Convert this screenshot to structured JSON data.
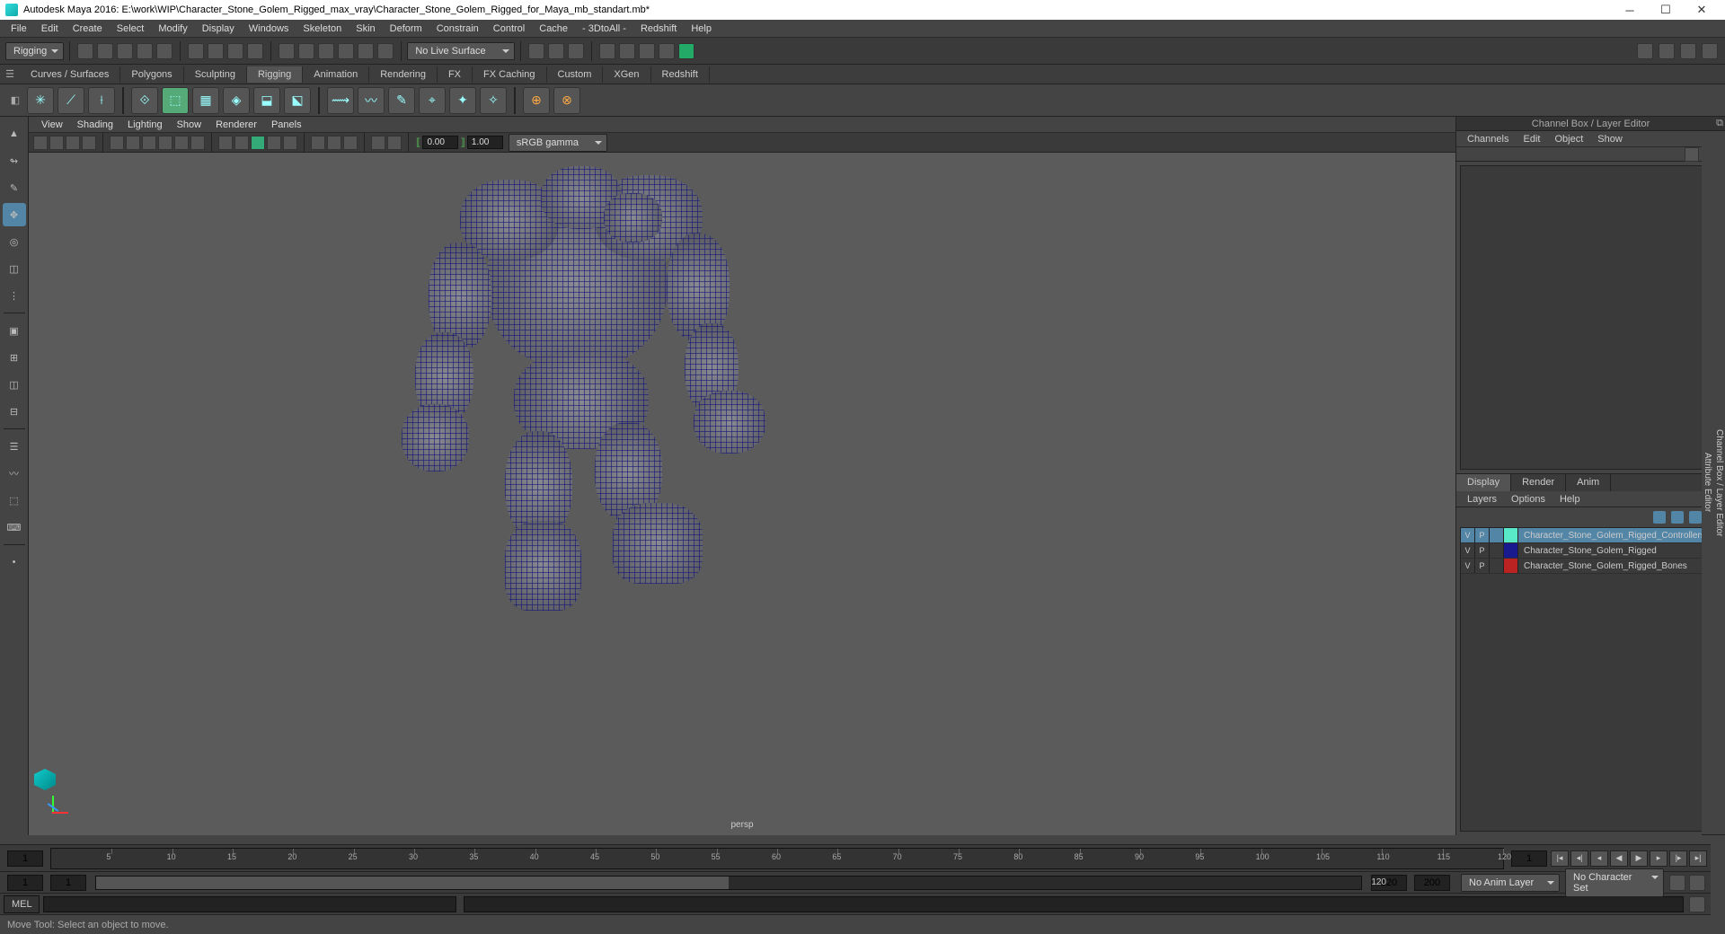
{
  "title": "Autodesk Maya 2016: E:\\work\\WIP\\Character_Stone_Golem_Rigged_max_vray\\Character_Stone_Golem_Rigged_for_Maya_mb_standart.mb*",
  "menus": [
    "File",
    "Edit",
    "Create",
    "Select",
    "Modify",
    "Display",
    "Windows",
    "Skeleton",
    "Skin",
    "Deform",
    "Constrain",
    "Control",
    "Cache",
    "- 3DtoAll -",
    "Redshift",
    "Help"
  ],
  "workspace_dd": "Rigging",
  "live_surface": "No Live Surface",
  "shelf_tabs": [
    "Curves / Surfaces",
    "Polygons",
    "Sculpting",
    "Rigging",
    "Animation",
    "Rendering",
    "FX",
    "FX Caching",
    "Custom",
    "XGen",
    "Redshift"
  ],
  "shelf_active": "Rigging",
  "viewport_menu": [
    "View",
    "Shading",
    "Lighting",
    "Show",
    "Renderer",
    "Panels"
  ],
  "near": "0.00",
  "far": "1.00",
  "color_dd": "sRGB gamma",
  "camera": "persp",
  "rpanel_title": "Channel Box / Layer Editor",
  "chmenu": [
    "Channels",
    "Edit",
    "Object",
    "Show"
  ],
  "laytabs": [
    "Display",
    "Render",
    "Anim"
  ],
  "laymenu": [
    "Layers",
    "Options",
    "Help"
  ],
  "layers": [
    {
      "v": "V",
      "p": "P",
      "color": "#59e8c8",
      "name": "Character_Stone_Golem_Rigged_Controllers",
      "sel": true
    },
    {
      "v": "V",
      "p": "P",
      "color": "#1a1a8f",
      "name": "Character_Stone_Golem_Rigged",
      "sel": false
    },
    {
      "v": "V",
      "p": "P",
      "color": "#b22",
      "name": "Character_Stone_Golem_Rigged_Bones",
      "sel": false
    }
  ],
  "side_tabs": [
    "Channel Box / Layer Editor",
    "Attribute Editor"
  ],
  "time_start": "1",
  "time_end": "1",
  "range_s": "1",
  "range_e": "1",
  "range_num": "120",
  "pb_s": "120",
  "pb_e": "200",
  "anim_layer": "No Anim Layer",
  "char_set": "No Character Set",
  "cmd_lang": "MEL",
  "helpline": "Move Tool: Select an object to move.",
  "ticks": [
    5,
    10,
    15,
    20,
    25,
    30,
    35,
    40,
    45,
    50,
    55,
    60,
    65,
    70,
    75,
    80,
    85,
    90,
    95,
    100,
    105,
    110,
    115,
    120
  ]
}
